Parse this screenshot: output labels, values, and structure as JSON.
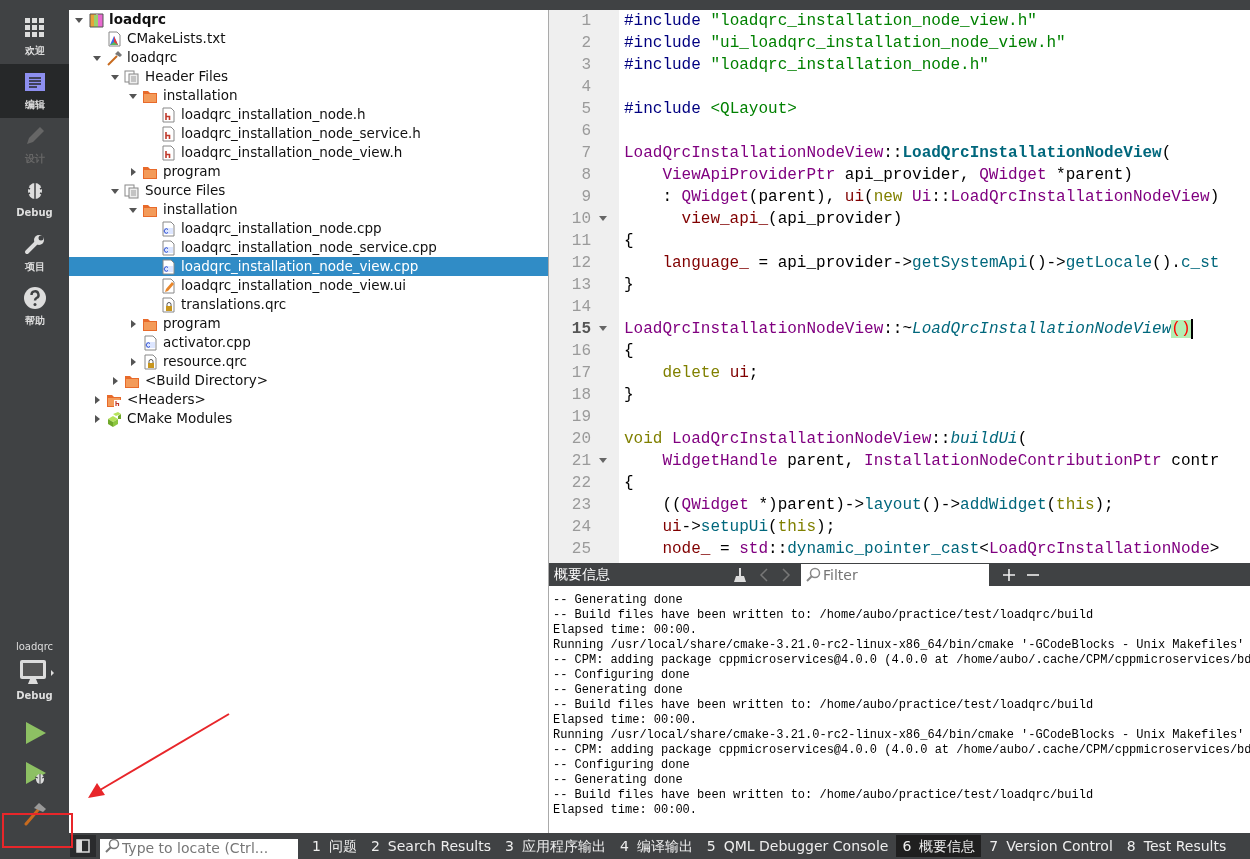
{
  "modes": [
    {
      "label": "欢迎",
      "selected": false,
      "disabled": false
    },
    {
      "label": "编辑",
      "selected": true,
      "disabled": false
    },
    {
      "label": "设计",
      "selected": false,
      "disabled": true
    },
    {
      "label": "Debug",
      "selected": false,
      "disabled": false
    },
    {
      "label": "项目",
      "selected": false,
      "disabled": false
    },
    {
      "label": "帮助",
      "selected": false,
      "disabled": false
    }
  ],
  "target": {
    "project": "loadqrc",
    "config": "Debug"
  },
  "actions": [
    {
      "kind": "run"
    },
    {
      "kind": "debug-run"
    },
    {
      "kind": "build"
    }
  ],
  "project_tree": [
    {
      "label": "loadqrc",
      "kind": "project",
      "selected": false,
      "expanded": true,
      "children": [
        {
          "label": "CMakeLists.txt",
          "kind": "cmake",
          "selected": false
        },
        {
          "label": "loadqrc",
          "kind": "target",
          "selected": false,
          "expanded": true,
          "children": [
            {
              "label": "Header Files",
              "kind": "group",
              "selected": false,
              "expanded": true,
              "children": [
                {
                  "label": "installation",
                  "kind": "folder",
                  "selected": false,
                  "expanded": true,
                  "children": [
                    {
                      "label": "loadqrc_installation_node.h",
                      "kind": "header",
                      "selected": false
                    },
                    {
                      "label": "loadqrc_installation_node_service.h",
                      "kind": "header",
                      "selected": false
                    },
                    {
                      "label": "loadqrc_installation_node_view.h",
                      "kind": "header",
                      "selected": false
                    }
                  ]
                },
                {
                  "label": "program",
                  "kind": "folder",
                  "selected": false,
                  "expanded": false
                }
              ]
            },
            {
              "label": "Source Files",
              "kind": "group",
              "selected": false,
              "expanded": true,
              "children": [
                {
                  "label": "installation",
                  "kind": "folder",
                  "selected": false,
                  "expanded": true,
                  "children": [
                    {
                      "label": "loadqrc_installation_node.cpp",
                      "kind": "source",
                      "selected": false
                    },
                    {
                      "label": "loadqrc_installation_node_service.cpp",
                      "kind": "source",
                      "selected": false
                    },
                    {
                      "label": "loadqrc_installation_node_view.cpp",
                      "kind": "source",
                      "selected": true
                    },
                    {
                      "label": "loadqrc_installation_node_view.ui",
                      "kind": "form",
                      "selected": false
                    },
                    {
                      "label": "translations.qrc",
                      "kind": "resource",
                      "selected": false
                    }
                  ]
                },
                {
                  "label": "program",
                  "kind": "folder",
                  "selected": false,
                  "expanded": false
                },
                {
                  "label": "activator.cpp",
                  "kind": "source",
                  "selected": false
                },
                {
                  "label": "resource.qrc",
                  "kind": "resource",
                  "selected": false,
                  "expanded": false
                }
              ]
            },
            {
              "label": "<Build Directory>",
              "kind": "folder",
              "selected": false,
              "expanded": false
            }
          ]
        },
        {
          "label": "<Headers>",
          "kind": "headers-folder",
          "selected": false,
          "expanded": false
        },
        {
          "label": "CMake Modules",
          "kind": "modules",
          "selected": false,
          "expanded": false
        }
      ]
    }
  ],
  "editor": {
    "lines": [
      {
        "number": "1",
        "fold": false,
        "current": false,
        "tokens": [
          {
            "kind": "preproc",
            "text": "#include "
          },
          {
            "kind": "string",
            "text": "\"loadqrc_installation_node_view.h\""
          }
        ]
      },
      {
        "number": "2",
        "fold": false,
        "current": false,
        "tokens": [
          {
            "kind": "preproc",
            "text": "#include "
          },
          {
            "kind": "string",
            "text": "\"ui_loadqrc_installation_node_view.h\""
          }
        ]
      },
      {
        "number": "3",
        "fold": false,
        "current": false,
        "tokens": [
          {
            "kind": "preproc",
            "text": "#include "
          },
          {
            "kind": "string",
            "text": "\"loadqrc_installation_node.h\""
          }
        ]
      },
      {
        "number": "4",
        "fold": false,
        "current": false
      },
      {
        "number": "5",
        "fold": false,
        "current": false,
        "tokens": [
          {
            "kind": "preproc",
            "text": "#include "
          },
          {
            "kind": "string",
            "text": "<QLayout>"
          }
        ]
      },
      {
        "number": "6",
        "fold": false,
        "current": false
      },
      {
        "number": "7",
        "fold": false,
        "current": false,
        "tokens": [
          {
            "kind": "type",
            "text": "LoadQrcInstallationNodeView"
          },
          {
            "kind": "plain",
            "text": "::"
          },
          {
            "kind": "declaration",
            "text": "LoadQrcInstallationNodeView"
          },
          {
            "kind": "plain",
            "text": "("
          }
        ]
      },
      {
        "number": "8",
        "fold": false,
        "current": false,
        "tokens": [
          {
            "kind": "type",
            "text": "    ViewApiProviderPtr"
          },
          {
            "kind": "plain",
            "text": " api_provider, "
          },
          {
            "kind": "type",
            "text": "QWidget"
          },
          {
            "kind": "plain",
            "text": " *parent)"
          }
        ]
      },
      {
        "number": "9",
        "fold": false,
        "current": false,
        "tokens": [
          {
            "kind": "plain",
            "text": "    : "
          },
          {
            "kind": "type",
            "text": "QWidget"
          },
          {
            "kind": "plain",
            "text": "(parent), "
          },
          {
            "kind": "member",
            "text": "ui"
          },
          {
            "kind": "plain",
            "text": "("
          },
          {
            "kind": "keyword",
            "text": "new "
          },
          {
            "kind": "type",
            "text": "Ui"
          },
          {
            "kind": "plain",
            "text": "::"
          },
          {
            "kind": "type",
            "text": "LoadQrcInstallationNodeView"
          },
          {
            "kind": "plain",
            "text": ")"
          }
        ]
      },
      {
        "number": "10",
        "fold": true,
        "current": false,
        "tokens": [
          {
            "kind": "member",
            "text": "      view_api_"
          },
          {
            "kind": "plain",
            "text": "(api_provider)"
          }
        ]
      },
      {
        "number": "11",
        "fold": false,
        "current": false,
        "tokens": [
          {
            "kind": "plain",
            "text": "{"
          }
        ]
      },
      {
        "number": "12",
        "fold": false,
        "current": false,
        "tokens": [
          {
            "kind": "member",
            "text": "    language_"
          },
          {
            "kind": "plain",
            "text": " = api_provider->"
          },
          {
            "kind": "function",
            "text": "getSystemApi"
          },
          {
            "kind": "plain",
            "text": "()->"
          },
          {
            "kind": "function",
            "text": "getLocale"
          },
          {
            "kind": "plain",
            "text": "()."
          },
          {
            "kind": "function",
            "text": "c_st"
          }
        ]
      },
      {
        "number": "13",
        "fold": false,
        "current": false,
        "tokens": [
          {
            "kind": "plain",
            "text": "}"
          }
        ]
      },
      {
        "number": "14",
        "fold": false,
        "current": false
      },
      {
        "number": "15",
        "fold": true,
        "current": true,
        "tokens": [
          {
            "kind": "type",
            "text": "LoadQrcInstallationNodeView"
          },
          {
            "kind": "plain",
            "text": "::~"
          },
          {
            "kind": "virtual",
            "text": "LoadQrcInstallationNodeView"
          },
          {
            "kind": "match",
            "text": "()"
          }
        ]
      },
      {
        "number": "16",
        "fold": false,
        "current": false,
        "tokens": [
          {
            "kind": "plain",
            "text": "{"
          }
        ]
      },
      {
        "number": "17",
        "fold": false,
        "current": false,
        "tokens": [
          {
            "kind": "keyword",
            "text": "    delete "
          },
          {
            "kind": "member",
            "text": "ui"
          },
          {
            "kind": "plain",
            "text": ";"
          }
        ]
      },
      {
        "number": "18",
        "fold": false,
        "current": false,
        "tokens": [
          {
            "kind": "plain",
            "text": "}"
          }
        ]
      },
      {
        "number": "19",
        "fold": false,
        "current": false
      },
      {
        "number": "20",
        "fold": false,
        "current": false,
        "tokens": [
          {
            "kind": "keyword",
            "text": "void "
          },
          {
            "kind": "type",
            "text": "LoadQrcInstallationNodeView"
          },
          {
            "kind": "plain",
            "text": "::"
          },
          {
            "kind": "virtual",
            "text": "buildUi"
          },
          {
            "kind": "plain",
            "text": "("
          }
        ]
      },
      {
        "number": "21",
        "fold": true,
        "current": false,
        "tokens": [
          {
            "kind": "type",
            "text": "    WidgetHandle"
          },
          {
            "kind": "plain",
            "text": " parent, "
          },
          {
            "kind": "type",
            "text": "InstallationNodeContributionPtr"
          },
          {
            "kind": "plain",
            "text": " contr"
          }
        ]
      },
      {
        "number": "22",
        "fold": false,
        "current": false,
        "tokens": [
          {
            "kind": "plain",
            "text": "{"
          }
        ]
      },
      {
        "number": "23",
        "fold": false,
        "current": false,
        "tokens": [
          {
            "kind": "plain",
            "text": "    (("
          },
          {
            "kind": "type",
            "text": "QWidget"
          },
          {
            "kind": "plain",
            "text": " *)parent)->"
          },
          {
            "kind": "function",
            "text": "layout"
          },
          {
            "kind": "plain",
            "text": "()->"
          },
          {
            "kind": "function",
            "text": "addWidget"
          },
          {
            "kind": "plain",
            "text": "("
          },
          {
            "kind": "keyword",
            "text": "this"
          },
          {
            "kind": "plain",
            "text": ");"
          }
        ]
      },
      {
        "number": "24",
        "fold": false,
        "current": false,
        "tokens": [
          {
            "kind": "member",
            "text": "    ui"
          },
          {
            "kind": "plain",
            "text": "->"
          },
          {
            "kind": "function",
            "text": "setupUi"
          },
          {
            "kind": "plain",
            "text": "("
          },
          {
            "kind": "keyword",
            "text": "this"
          },
          {
            "kind": "plain",
            "text": ");"
          }
        ]
      },
      {
        "number": "25",
        "fold": false,
        "current": false,
        "tokens": [
          {
            "kind": "member",
            "text": "    node_"
          },
          {
            "kind": "plain",
            "text": " = "
          },
          {
            "kind": "type",
            "text": "std"
          },
          {
            "kind": "plain",
            "text": "::"
          },
          {
            "kind": "function",
            "text": "dynamic_pointer_cast"
          },
          {
            "kind": "plain",
            "text": "<"
          },
          {
            "kind": "type",
            "text": "LoadQrcInstallationNode"
          },
          {
            "kind": "plain",
            "text": ">"
          }
        ]
      }
    ]
  },
  "output_pane": {
    "title": "概要信息",
    "filter": {
      "placeholder": "Filter"
    },
    "lines": [
      "-- Generating done",
      "-- Build files have been written to: /home/aubo/practice/test/loadqrc/build",
      "Elapsed time: 00:00.",
      "Running /usr/local/share/cmake-3.21.0-rc2-linux-x86_64/bin/cmake '-GCodeBlocks - Unix Makefiles'",
      "-- CPM: adding package cppmicroservices@4.0.0 (4.0.0 at /home/aubo/.cache/CPM/cppmicroservices/bd",
      "-- Configuring done",
      "-- Generating done",
      "-- Build files have been written to: /home/aubo/practice/test/loadqrc/build",
      "Elapsed time: 00:00.",
      "Running /usr/local/share/cmake-3.21.0-rc2-linux-x86_64/bin/cmake '-GCodeBlocks - Unix Makefiles'",
      "-- CPM: adding package cppmicroservices@4.0.0 (4.0.0 at /home/aubo/.cache/CPM/cppmicroservices/bd",
      "-- Configuring done",
      "-- Generating done",
      "-- Build files have been written to: /home/aubo/practice/test/loadqrc/build",
      "Elapsed time: 00:00."
    ]
  },
  "status_bar": {
    "locate": {
      "placeholder": "Type to locate (Ctrl..."
    },
    "tabs": [
      {
        "number": "1",
        "label": "问题",
        "selected": false
      },
      {
        "number": "2",
        "label": "Search Results",
        "selected": false
      },
      {
        "number": "3",
        "label": "应用程序输出",
        "selected": false
      },
      {
        "number": "4",
        "label": "编译输出",
        "selected": false
      },
      {
        "number": "5",
        "label": "QML Debugger Console",
        "selected": false
      },
      {
        "number": "6",
        "label": "概要信息",
        "selected": true
      },
      {
        "number": "7",
        "label": "Version Control",
        "selected": false
      },
      {
        "number": "8",
        "label": "Test Results",
        "selected": false
      }
    ]
  }
}
